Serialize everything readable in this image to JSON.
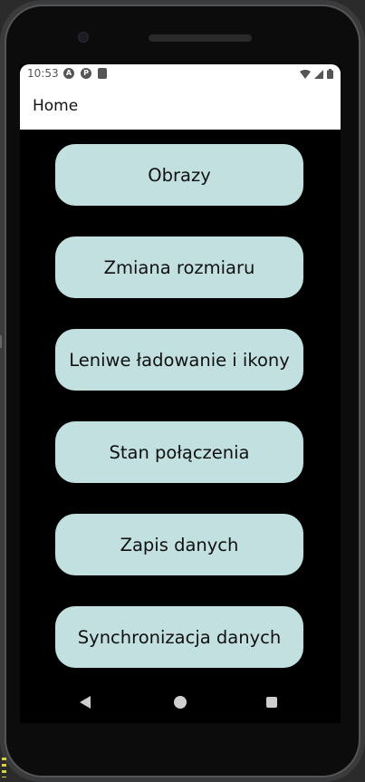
{
  "status_bar": {
    "time": "10:53",
    "left_icons": [
      "a-circle-icon",
      "p-circle-icon",
      "sd-card-icon"
    ],
    "right_icons": [
      "wifi-icon",
      "signal-icon",
      "battery-icon"
    ]
  },
  "app_bar": {
    "title": "Home"
  },
  "menu": {
    "buttons": [
      {
        "label": "Obrazy"
      },
      {
        "label": "Zmiana rozmiaru"
      },
      {
        "label": "Leniwe ładowanie i ikony"
      },
      {
        "label": "Stan połączenia"
      },
      {
        "label": "Zapis danych"
      },
      {
        "label": "Synchronizacja danych"
      }
    ]
  },
  "nav_bar": {
    "items": [
      "back-icon",
      "home-icon",
      "recent-apps-icon"
    ]
  },
  "colors": {
    "button_bg": "#c2e0df",
    "app_bar_bg": "#ffffff",
    "screen_bg": "#000000"
  }
}
